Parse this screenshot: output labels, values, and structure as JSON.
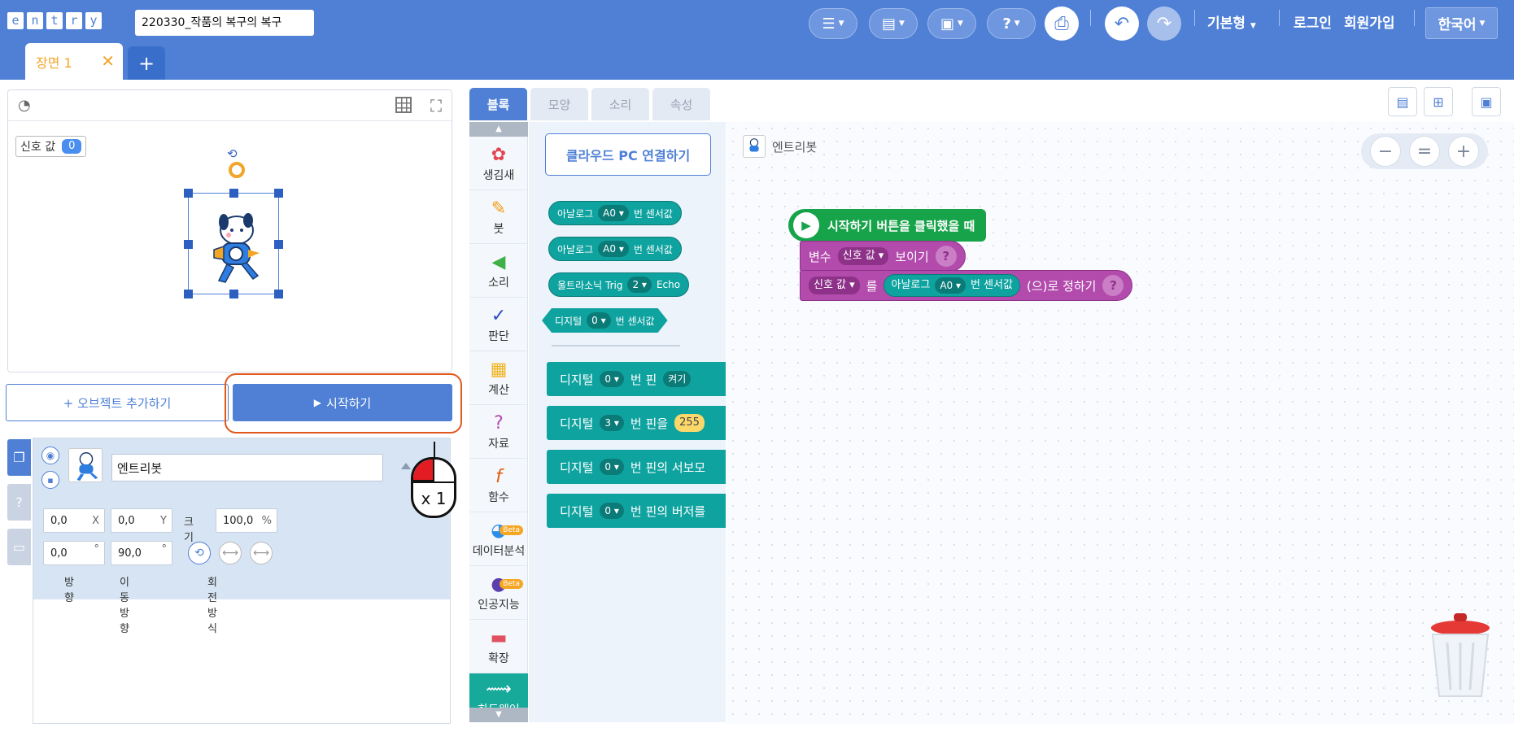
{
  "header": {
    "logo_letters": [
      "e",
      "n",
      "t",
      "r",
      "y"
    ],
    "project_title": "220330_작품의 복구의 복구",
    "mode_label": "기본형",
    "login_label": "로그인",
    "signup_label": "회원가입",
    "language_label": "한국어"
  },
  "scene": {
    "tab_label": "장면 1",
    "close_glyph": "✕",
    "add_glyph": "+"
  },
  "stage": {
    "variable_monitor": {
      "name": "신호 값",
      "value": "0"
    }
  },
  "buttons": {
    "add_object": "+ 오브젝트 추가하기",
    "start": "시작하기"
  },
  "object": {
    "name": "엔트리봇",
    "x": "0,0",
    "x_unit": "X",
    "y": "0,0",
    "y_unit": "Y",
    "size_label": "크기",
    "size": "100,0",
    "size_unit": "%",
    "direction": "0,0",
    "direction_unit": "°",
    "move_direction": "90,0",
    "move_direction_unit": "°",
    "direction_label": "방향",
    "move_direction_label": "이동 방향",
    "rotation_mode_label": "회전방식"
  },
  "mouse_indicator": {
    "count": "x 1"
  },
  "block_tabs": [
    {
      "label": "블록"
    },
    {
      "label": "모양"
    },
    {
      "label": "소리"
    },
    {
      "label": "속성"
    }
  ],
  "categories": [
    {
      "label": "생김새",
      "icon": "looks-icon",
      "color": "#e2454f"
    },
    {
      "label": "붓",
      "icon": "brush-icon",
      "color": "#f39c12"
    },
    {
      "label": "소리",
      "icon": "sound-icon",
      "color": "#3db048"
    },
    {
      "label": "판단",
      "icon": "judgement-icon",
      "color": "#2b4cc0"
    },
    {
      "label": "계산",
      "icon": "calc-icon",
      "color": "#f2b21b"
    },
    {
      "label": "자료",
      "icon": "data-icon",
      "color": "#b34bad"
    },
    {
      "label": "함수",
      "icon": "function-icon",
      "color": "#e15a0e"
    },
    {
      "label": "데이터분석",
      "icon": "analysis-icon",
      "color": "#2b8de8",
      "badge": "Beta"
    },
    {
      "label": "인공지능",
      "icon": "ai-icon",
      "color": "#5b3dae",
      "badge": "Beta"
    },
    {
      "label": "확장",
      "icon": "expansion-icon",
      "color": "#e05160"
    },
    {
      "label": "하드웨어",
      "icon": "hardware-icon",
      "color": "#ffffff"
    }
  ],
  "palette": {
    "cloud_button": "클라우드 PC 연결하기",
    "analog1": {
      "prefix": "아날로그",
      "port": "A0 ▾",
      "suffix": "번 센서값"
    },
    "analog2": {
      "prefix": "아날로그",
      "port": "A0 ▾",
      "suffix": "번 센서값"
    },
    "ultrasonic": {
      "prefix": "울트라소닉 Trig",
      "trig": "2 ▾",
      "echo": "Echo"
    },
    "digital_sensor": {
      "prefix": "디지털",
      "port": "0 ▾",
      "suffix": "번 센서값"
    },
    "stack_blocks": [
      {
        "prefix": "디지털",
        "port": "0 ▾",
        "suffix": "번 핀",
        "extra": "켜기"
      },
      {
        "prefix": "디지털",
        "port": "3 ▾",
        "suffix": "번 핀을",
        "extra": "255"
      },
      {
        "prefix": "디지털",
        "port": "0 ▾",
        "suffix": "번 핀의 서보모"
      },
      {
        "prefix": "디지털",
        "port": "0 ▾",
        "suffix": "번 핀의 버저를"
      }
    ]
  },
  "workspace": {
    "object_name": "엔트리봇",
    "trigger_label": "시작하기 버튼을 클릭했을 때",
    "show_var": {
      "prefix": "변수",
      "var": "신호 값 ▾",
      "suffix": "보이기",
      "help": "?"
    },
    "set_var": {
      "var": "신호 값 ▾",
      "particle": "를",
      "analog": "아날로그",
      "port": "A0 ▾",
      "sensor": "번 센서값",
      "suffix": "(으)로 정하기",
      "help": "?"
    }
  },
  "colors": {
    "header": "#4f80d6",
    "hardware_block": "#0fa3a0",
    "variable_block": "#b34bad",
    "trigger_block": "#16a34a",
    "highlight": "#e0581c"
  }
}
